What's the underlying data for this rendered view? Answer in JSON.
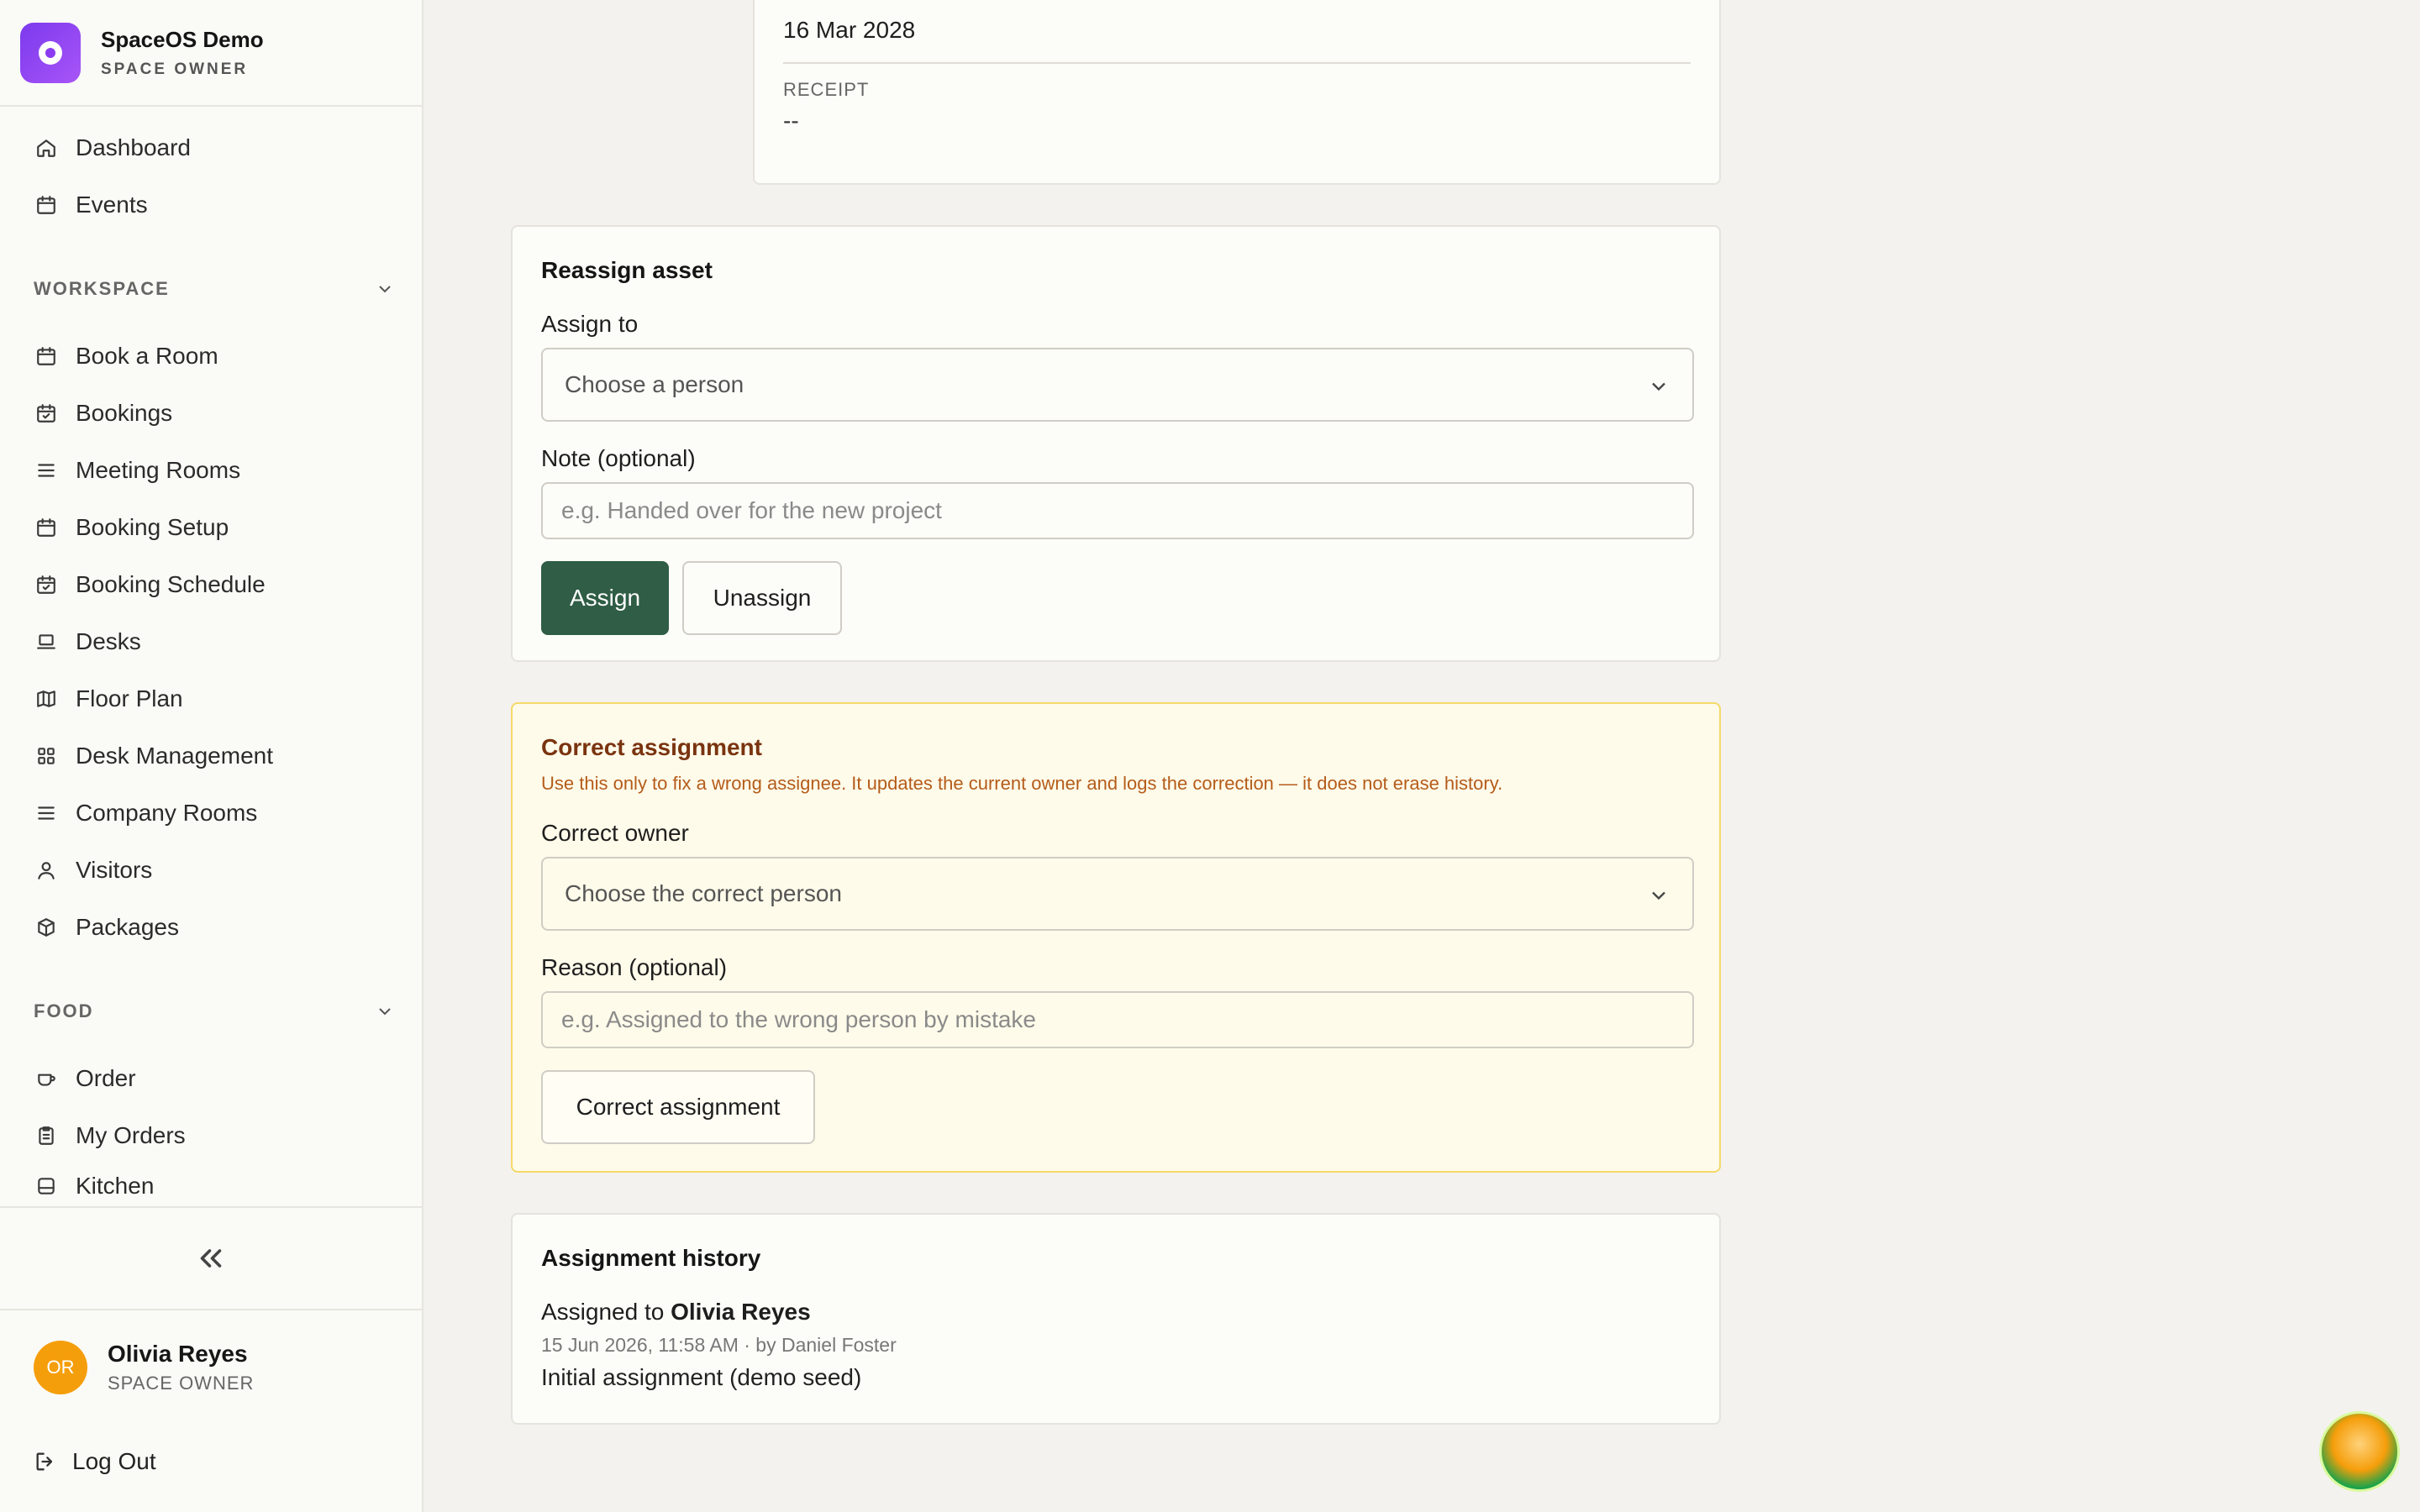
{
  "brand": {
    "name": "SpaceOS Demo",
    "role": "SPACE OWNER"
  },
  "nav": {
    "top": [
      {
        "label": "Dashboard",
        "icon": "home-icon"
      },
      {
        "label": "Events",
        "icon": "calendar-icon"
      }
    ],
    "workspace_header": "WORKSPACE",
    "workspace": [
      {
        "label": "Book a Room",
        "icon": "calendar-icon"
      },
      {
        "label": "Bookings",
        "icon": "calendar-check-icon"
      },
      {
        "label": "Meeting Rooms",
        "icon": "list-icon"
      },
      {
        "label": "Booking Setup",
        "icon": "calendar-icon"
      },
      {
        "label": "Booking Schedule",
        "icon": "calendar-check-icon"
      },
      {
        "label": "Desks",
        "icon": "laptop-icon"
      },
      {
        "label": "Floor Plan",
        "icon": "map-icon"
      },
      {
        "label": "Desk Management",
        "icon": "grid-icon"
      },
      {
        "label": "Company Rooms",
        "icon": "list-icon"
      },
      {
        "label": "Visitors",
        "icon": "user-icon"
      },
      {
        "label": "Packages",
        "icon": "package-icon"
      }
    ],
    "food_header": "FOOD",
    "food": [
      {
        "label": "Order",
        "icon": "cup-icon"
      },
      {
        "label": "My Orders",
        "icon": "clipboard-icon"
      },
      {
        "label": "Kitchen",
        "icon": "kitchen-icon"
      }
    ]
  },
  "user": {
    "initials": "OR",
    "name": "Olivia Reyes",
    "role": "SPACE OWNER"
  },
  "logout_label": "Log Out",
  "details": {
    "date": "16 Mar 2028",
    "receipt_label": "RECEIPT",
    "receipt_value": "--"
  },
  "reassign": {
    "title": "Reassign asset",
    "assign_to_label": "Assign to",
    "assign_to_placeholder": "Choose a person",
    "note_label": "Note (optional)",
    "note_placeholder": "e.g. Handed over for the new project",
    "assign_button": "Assign",
    "unassign_button": "Unassign"
  },
  "correct": {
    "title": "Correct assignment",
    "description": "Use this only to fix a wrong assignee. It updates the current owner and logs the correction — it does not erase history.",
    "owner_label": "Correct owner",
    "owner_placeholder": "Choose the correct person",
    "reason_label": "Reason (optional)",
    "reason_placeholder": "e.g. Assigned to the wrong person by mistake",
    "button": "Correct assignment"
  },
  "history": {
    "title": "Assignment history",
    "entries": [
      {
        "prefix": "Assigned to",
        "person": "Olivia Reyes",
        "meta": "15 Jun 2026, 11:58 AM · by Daniel Foster",
        "note": "Initial assignment (demo seed)"
      }
    ]
  },
  "colors": {
    "primary": "#2f5d45",
    "brand": "#8b3cf0",
    "warning_bg": "#fffbea",
    "warning_border": "#f5d96b",
    "avatar": "#f59e0b"
  }
}
